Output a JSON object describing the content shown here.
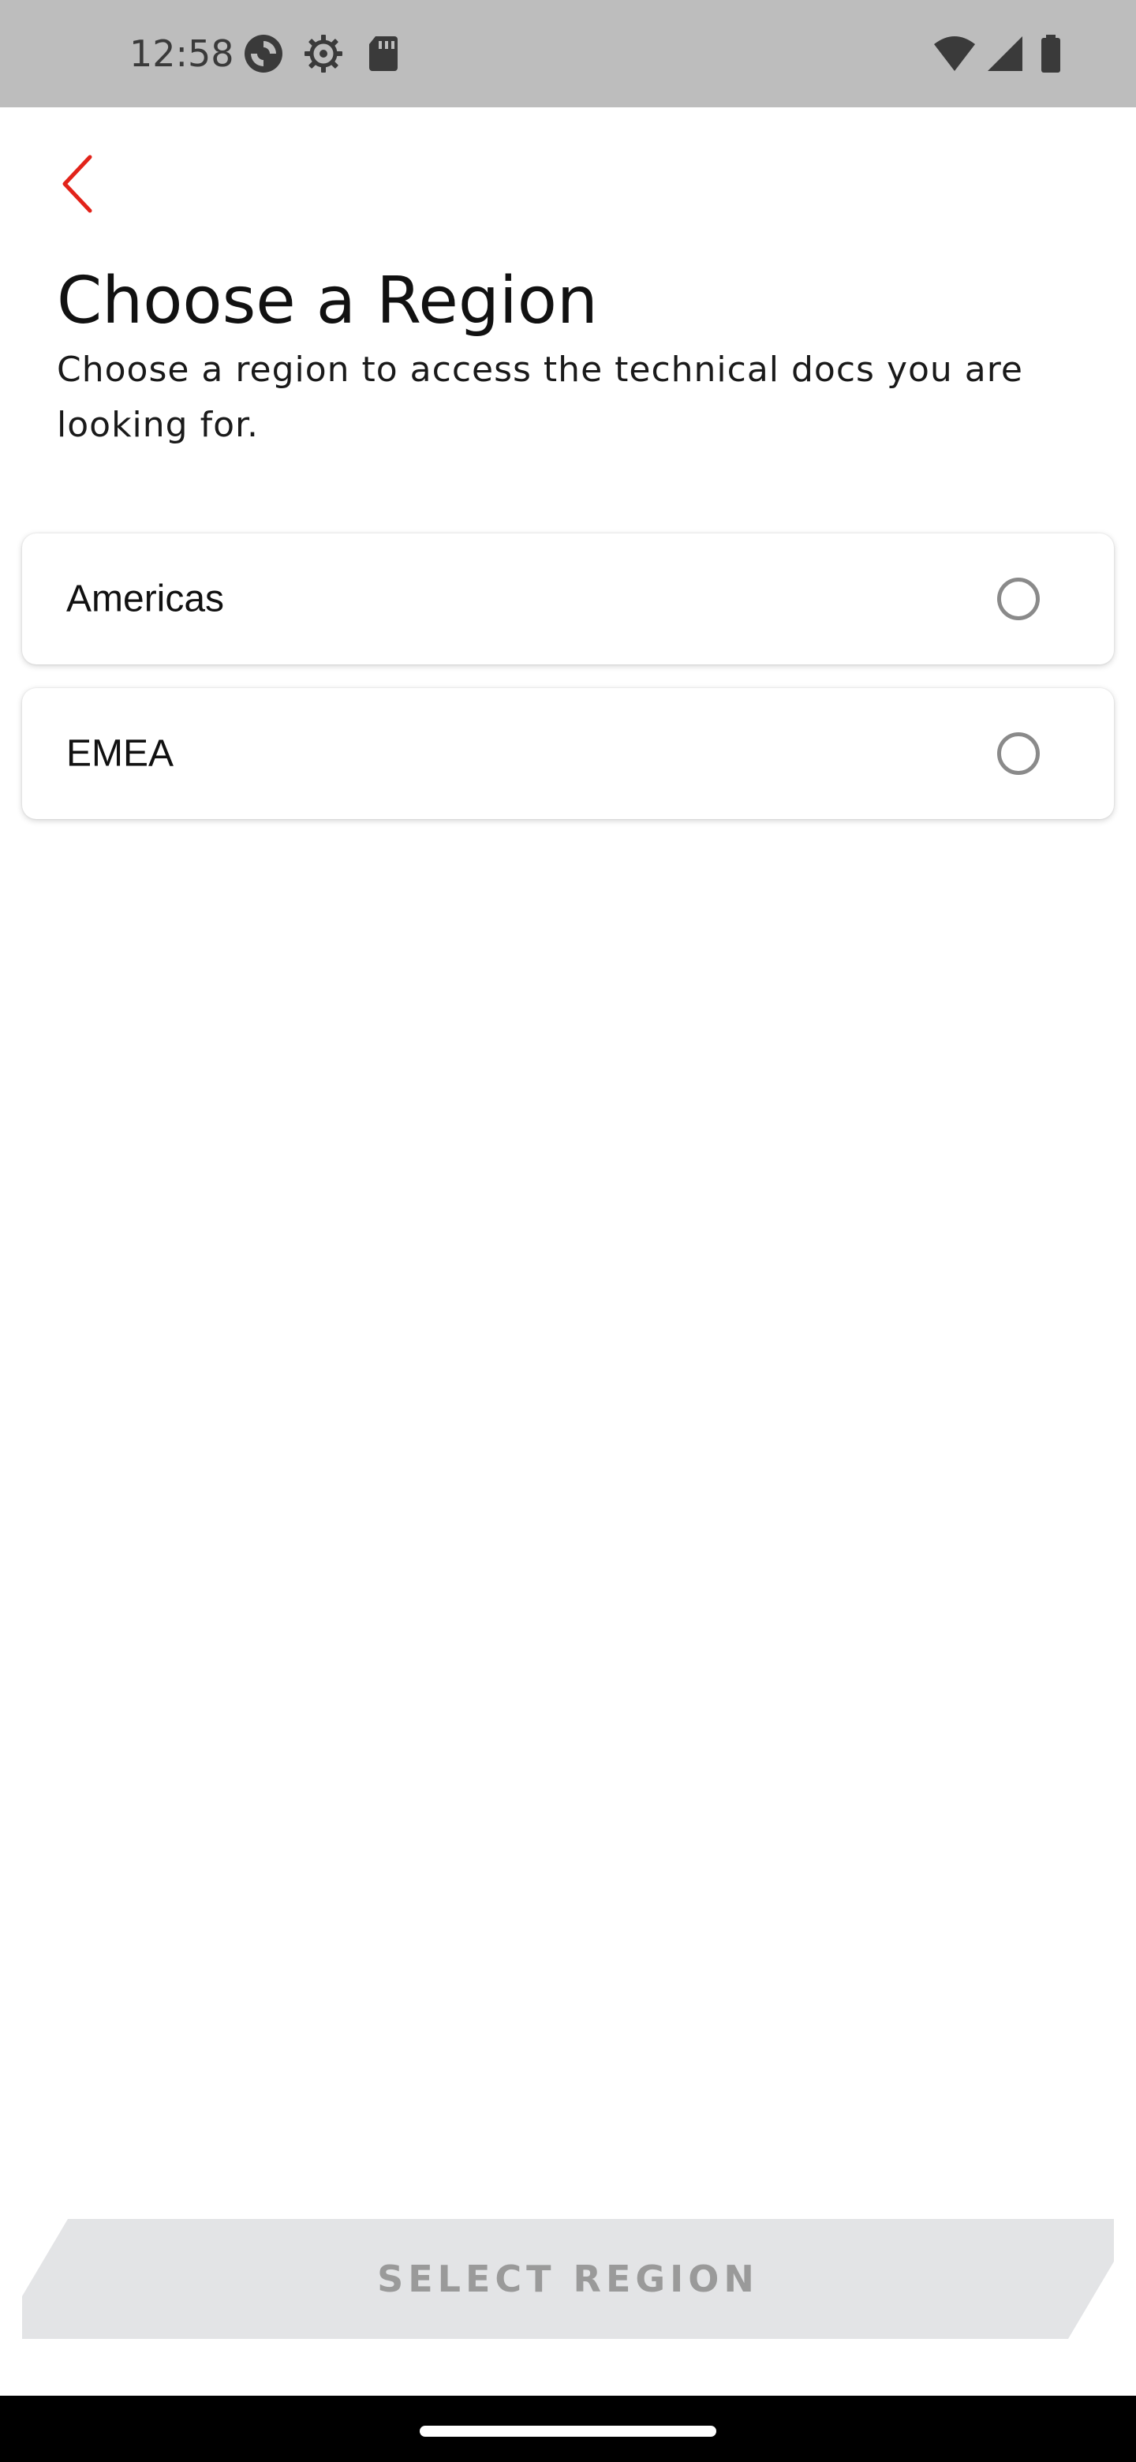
{
  "status_bar": {
    "time": "12:58",
    "icons": [
      "sync-icon",
      "settings-gear-icon",
      "sd-card-icon",
      "wifi-icon",
      "cell-signal-icon",
      "battery-icon"
    ]
  },
  "header": {
    "back_icon": "chevron-left-icon",
    "title": "Choose a Region",
    "subtitle": "Choose a region to access the technical docs you are looking for."
  },
  "regions": [
    {
      "label": "Americas",
      "selected": false
    },
    {
      "label": "EMEA",
      "selected": false
    }
  ],
  "actions": {
    "select_label": "SELECT REGION",
    "select_enabled": false
  },
  "colors": {
    "accent": "#e2231a",
    "status_bar_bg": "#bdbdbd",
    "button_disabled_bg": "#e3e4e6",
    "button_disabled_text": "#9a9a9a",
    "radio_border": "#8a8a8a"
  }
}
